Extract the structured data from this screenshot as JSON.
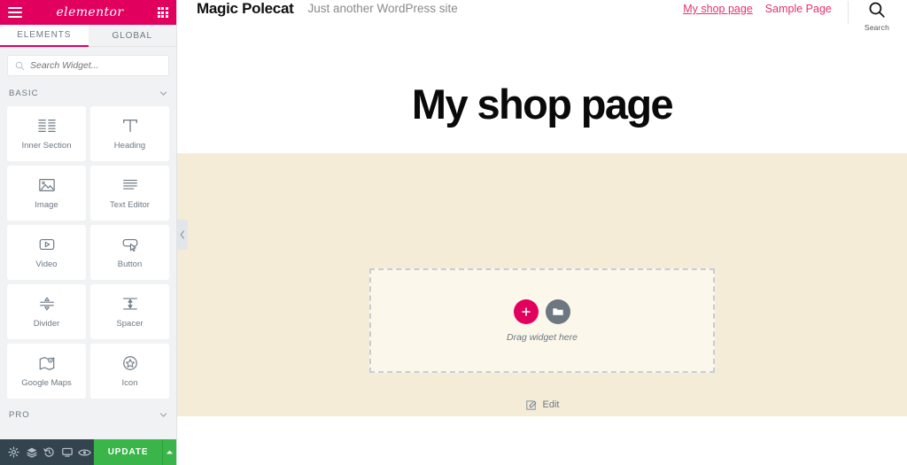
{
  "editor": {
    "brand_color": "#e2005f",
    "logo_text": "elementor",
    "menu_icon": "hamburger-icon",
    "apps_icon": "grid-apps-icon",
    "tabs": [
      {
        "label": "ELEMENTS",
        "active": true
      },
      {
        "label": "GLOBAL",
        "active": false
      }
    ],
    "search": {
      "placeholder": "Search Widget...",
      "value": "",
      "icon": "search-icon"
    },
    "sections": [
      {
        "label": "BASIC",
        "expanded": true
      },
      {
        "label": "PRO",
        "expanded": false
      }
    ],
    "widgets": [
      {
        "label": "Inner Section",
        "icon": "columns-icon"
      },
      {
        "label": "Heading",
        "icon": "text-t-icon"
      },
      {
        "label": "Image",
        "icon": "picture-icon"
      },
      {
        "label": "Text Editor",
        "icon": "paragraph-lines-icon"
      },
      {
        "label": "Video",
        "icon": "play-rect-icon"
      },
      {
        "label": "Button",
        "icon": "button-cursor-icon"
      },
      {
        "label": "Divider",
        "icon": "divider-arrows-icon"
      },
      {
        "label": "Spacer",
        "icon": "spacer-arrows-icon"
      },
      {
        "label": "Google Maps",
        "icon": "map-pin-icon"
      },
      {
        "label": "Icon",
        "icon": "star-circle-icon"
      }
    ],
    "footer": {
      "buttons": [
        {
          "name": "settings-icon",
          "title": "Settings"
        },
        {
          "name": "navigator-layers-icon",
          "title": "Navigator"
        },
        {
          "name": "history-icon",
          "title": "History"
        },
        {
          "name": "responsive-mode-icon",
          "title": "Responsive Mode"
        },
        {
          "name": "preview-eye-icon",
          "title": "Preview Changes"
        }
      ],
      "update_label": "UPDATE",
      "update_color": "#39b54a",
      "caret_icon": "caret-up-icon"
    },
    "collapse_icon": "chevron-left-icon"
  },
  "site": {
    "title": "Magic Polecat",
    "tagline": "Just another WordPress site",
    "nav": [
      {
        "label": "My shop page",
        "current": true
      },
      {
        "label": "Sample Page",
        "current": false
      }
    ],
    "search": {
      "label": "Search",
      "icon": "search-icon"
    },
    "link_color": "#e5326b"
  },
  "page": {
    "heading": "My shop page",
    "section_background": "#f5ecd7",
    "dropzone": {
      "hint": "Drag widget here",
      "add_icon": "plus-icon",
      "template_icon": "folder-icon"
    },
    "edit_bar": {
      "label": "Edit",
      "icon": "edit-pencil-icon"
    }
  }
}
